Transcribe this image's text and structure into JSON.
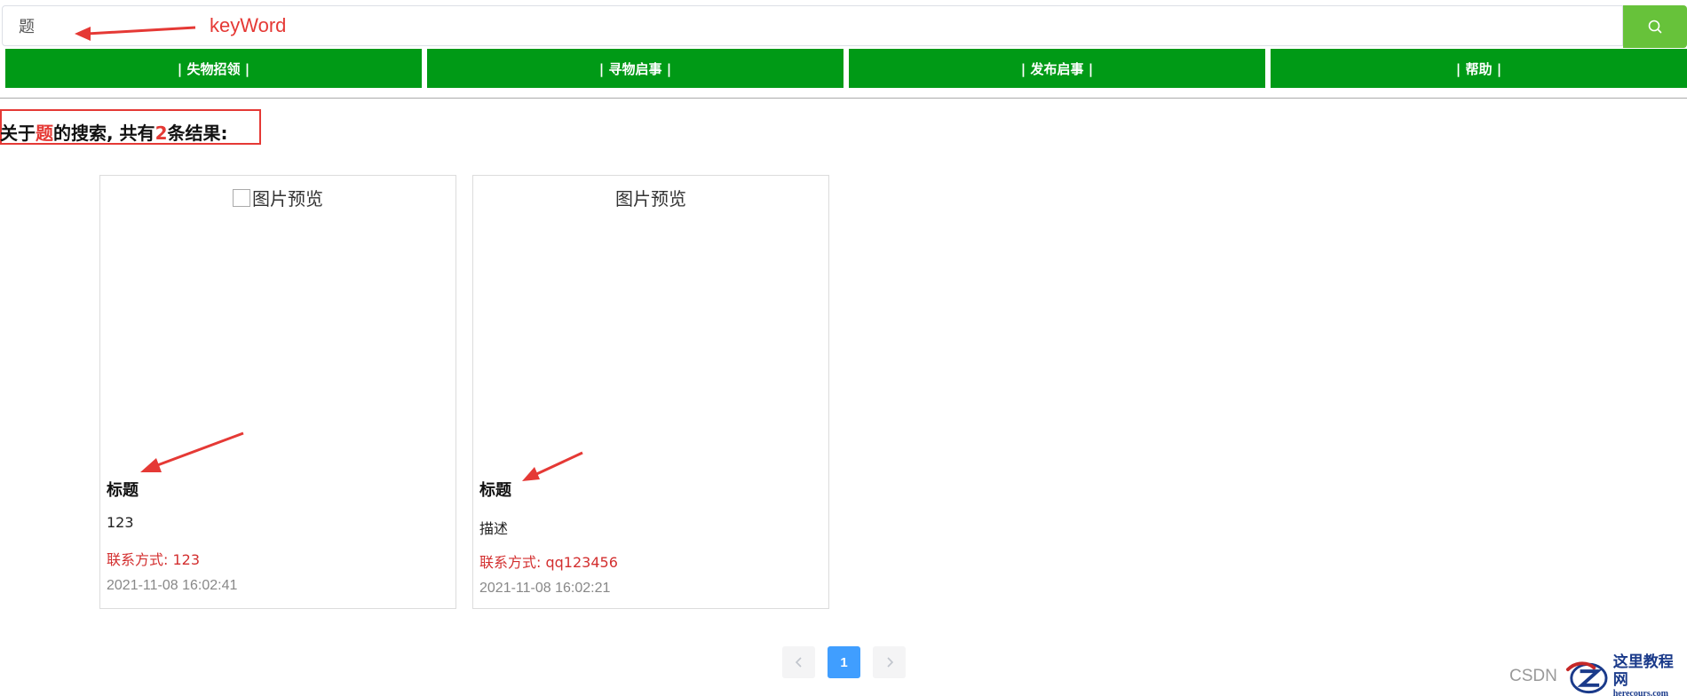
{
  "search": {
    "value": "题",
    "annotation": "keyWord",
    "icon": "search-icon"
  },
  "nav": {
    "items": [
      {
        "label": "| 失物招领 |"
      },
      {
        "label": "| 寻物启事 |"
      },
      {
        "label": "| 发布启事 |"
      },
      {
        "label": "| 帮助 |"
      }
    ]
  },
  "result": {
    "prefix": "关于",
    "keyword": "题",
    "middle": "的搜索, 共有",
    "count": "2",
    "suffix": "条结果:"
  },
  "cards": [
    {
      "image_alt": "图片预览",
      "title": "标题",
      "desc": "123",
      "contact": "联系方式: 123",
      "date": "2021-11-08 16:02:41"
    },
    {
      "image_alt": "图片预览",
      "title": "标题",
      "desc": "描述",
      "contact": "联系方式: qq123456",
      "date": "2021-11-08 16:02:21"
    }
  ],
  "pagination": {
    "current": "1",
    "prev_icon": "chevron-left-icon",
    "next_icon": "chevron-right-icon"
  },
  "watermark": {
    "csdn": "CSDN",
    "site_cn": "这里教程网",
    "site_en": "herecours.com"
  },
  "colors": {
    "nav_green": "#009a16",
    "search_button_green": "#67c23a",
    "annotation_red": "#e53935",
    "pager_blue": "#409eff"
  }
}
